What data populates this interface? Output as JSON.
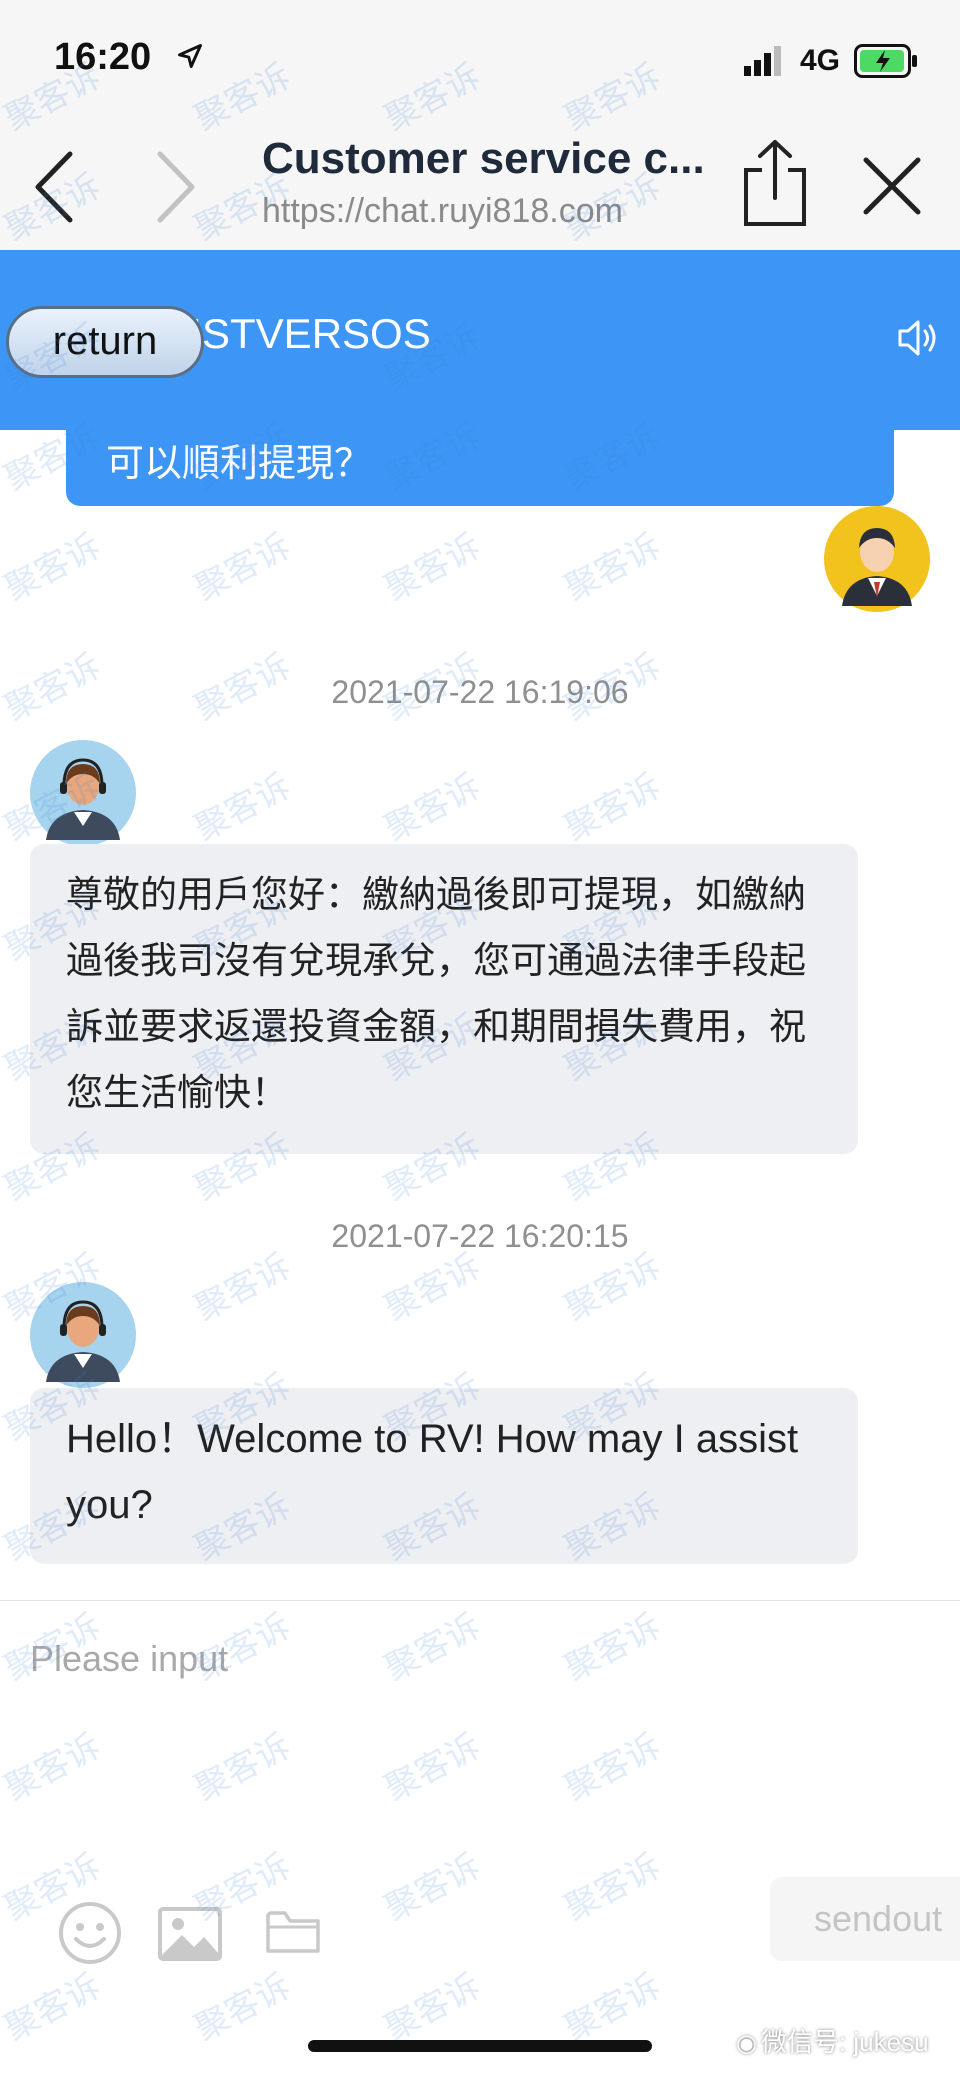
{
  "status_bar": {
    "time": "16:20",
    "network": "4G"
  },
  "browser": {
    "title": "Customer service c...",
    "url": "https://chat.ruyi818.com"
  },
  "app_header": {
    "return_label": "return",
    "title": "RISTVERSOS"
  },
  "messages": {
    "user_partial": "可以順利提現？",
    "timestamp_1": "2021-07-22 16:19:06",
    "agent_reply_1": "尊敬的用戶您好：繳納過後即可提現，如繳納過後我司沒有兌現承兌，您可通過法律手段起訴並要求返還投資金額，和期間損失費用，祝您生活愉快！",
    "timestamp_2": "2021-07-22 16:20:15",
    "agent_reply_2": "Hello！Welcome to RV! How may I assist you?"
  },
  "composer": {
    "placeholder": "Please input",
    "send_label": "sendout"
  },
  "watermark": {
    "text": "聚客诉",
    "wechat_prefix": "微信号: ",
    "wechat_id": "jukesu"
  },
  "colors": {
    "accent": "#3d96f5",
    "agent_bubble": "#eeeff2"
  }
}
